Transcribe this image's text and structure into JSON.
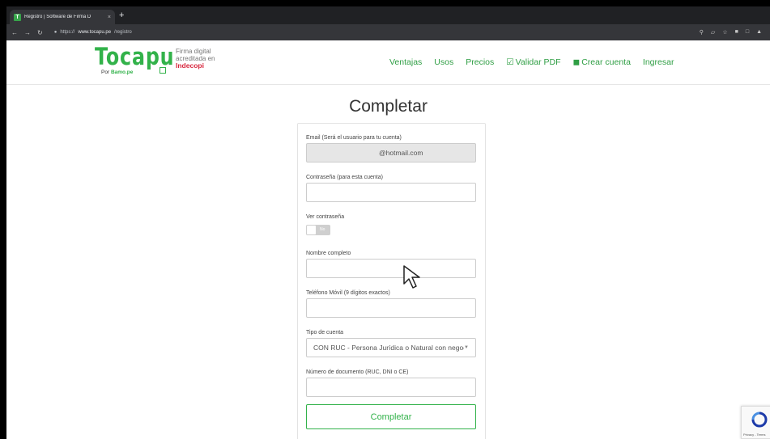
{
  "browser": {
    "tab_title": "Registro | Software de Firma D",
    "tab_close": "×",
    "new_tab": "+",
    "url_scheme": "https://",
    "url_host": "www.tocapu.pe",
    "url_path": "/registro"
  },
  "header": {
    "logo_text": "Tocapu",
    "logo_by": "Por",
    "logo_brand": "Bamo.pe",
    "cert_line1": "Firma digital",
    "cert_line2": "acreditada en",
    "cert_authority": "Indecopi",
    "nav": {
      "ventajas": "Ventajas",
      "usos": "Usos",
      "precios": "Precios",
      "validar": "Validar PDF",
      "crear": "Crear cuenta",
      "ingresar": "Ingresar"
    }
  },
  "form": {
    "title": "Completar",
    "email_label": "Email (Será el usuario para tu cuenta)",
    "email_value": "@hotmail.com",
    "password_label": "Contraseña (para esta cuenta)",
    "show_password_label": "Ver contraseña",
    "toggle_text": "No",
    "fullname_label": "Nombre completo",
    "phone_label": "Teléfono Móvil (9 dígitos exactos)",
    "account_type_label": "Tipo de cuenta",
    "account_type_value": "CON RUC - Persona Jurídica o Natural con negocio",
    "docnum_label": "Número de documento (RUC, DNI o CE)",
    "submit_label": "Completar"
  },
  "recaptcha": {
    "text": "Privacy - Terms"
  },
  "colors": {
    "brand_green": "#32b24a",
    "authority_red": "#d7263d"
  }
}
